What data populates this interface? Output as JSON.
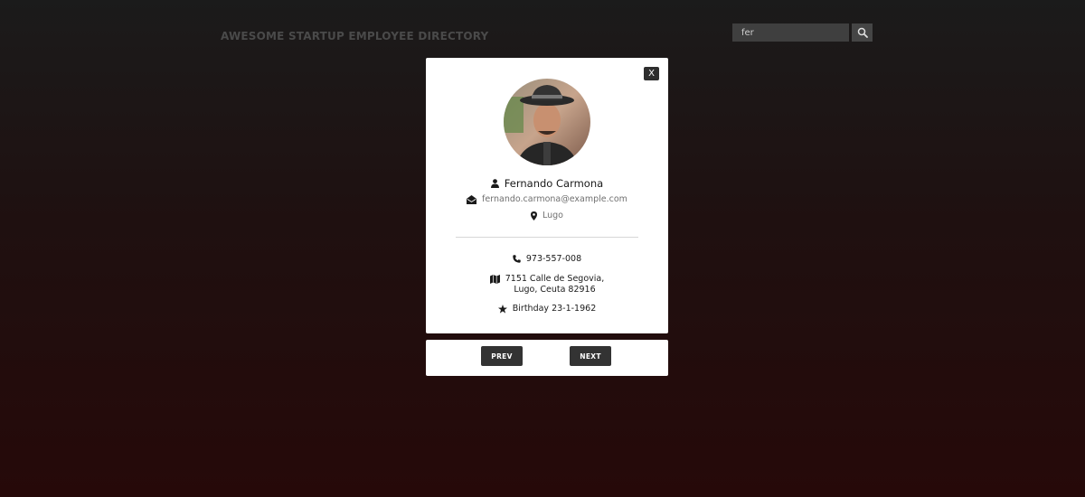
{
  "header": {
    "title": "AWESOME STARTUP EMPLOYEE DIRECTORY",
    "search_value": "fer",
    "search_icon": "magnifier-icon"
  },
  "modal": {
    "close_label": "X",
    "name": "Fernando Carmona",
    "email": "fernando.carmona@example.com",
    "city": "Lugo",
    "phone": "973-557-008",
    "address_line1": "7151 Calle de Segovia,",
    "address_line2": "Lugo, Ceuta 82916",
    "birthday": "Birthday 23-1-1962"
  },
  "navigation": {
    "prev_label": "PREV",
    "next_label": "NEXT"
  },
  "colors": {
    "button_dark": "#333333",
    "card_bg": "#ffffff"
  }
}
